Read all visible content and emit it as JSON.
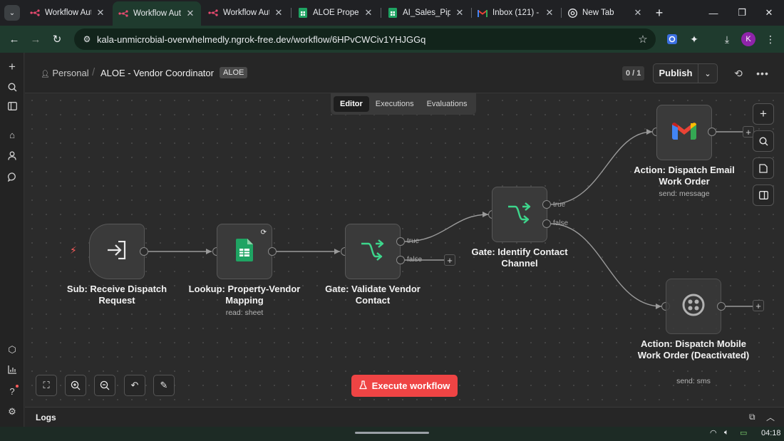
{
  "browser": {
    "tabs": [
      {
        "title": "Workflow Aut",
        "icon": "n8n-icon",
        "active": false
      },
      {
        "title": "Workflow Aut",
        "icon": "n8n-icon",
        "active": true
      },
      {
        "title": "Workflow Aut",
        "icon": "n8n-icon",
        "active": false
      },
      {
        "title": "ALOE Property",
        "icon": "sheets-icon",
        "active": false
      },
      {
        "title": "AI_Sales_Pipel",
        "icon": "sheets-icon",
        "active": false
      },
      {
        "title": "Inbox (121) - ",
        "icon": "gmail-icon",
        "active": false
      },
      {
        "title": "New Tab",
        "icon": "chrome-icon",
        "active": false
      }
    ],
    "url": "kala-unmicrobial-overwhelmedly.ngrok-free.dev/workflow/6HPvCWCiv1YHJGGq",
    "profile_initial": "K",
    "accent_color": "#1f3b2e"
  },
  "header": {
    "project": "Personal",
    "workflow_name": "ALOE - Vendor Coordinator",
    "tag": "ALOE",
    "counter": "0 / 1",
    "publish_label": "Publish"
  },
  "view_tabs": [
    "Editor",
    "Executions",
    "Evaluations"
  ],
  "active_view": "Editor",
  "nodes": [
    {
      "id": "n1",
      "title": "Sub: Receive Dispatch Request",
      "subtitle": "",
      "type": "trigger",
      "icon": "sign-in-icon"
    },
    {
      "id": "n2",
      "title": "Lookup: Property-Vendor Mapping",
      "subtitle": "read: sheet",
      "type": "google-sheets",
      "icon": "sheets-icon"
    },
    {
      "id": "n3",
      "title": "Gate: Validate Vendor Contact",
      "subtitle": "",
      "type": "if",
      "icon": "branch-icon"
    },
    {
      "id": "n4",
      "title": "Gate: Identify Contact Channel",
      "subtitle": "",
      "type": "if",
      "icon": "branch-icon"
    },
    {
      "id": "n5",
      "title": "Action: Dispatch Email Work Order",
      "subtitle": "send: message",
      "type": "gmail",
      "icon": "gmail-icon"
    },
    {
      "id": "n6",
      "title": "Action: Dispatch Mobile Work Order (Deactivated)",
      "subtitle": "send: sms",
      "type": "twilio",
      "icon": "twilio-icon"
    }
  ],
  "branch_labels": {
    "true": "true",
    "false": "false"
  },
  "execute_label": "Execute workflow",
  "logs_label": "Logs",
  "clock": "04:18",
  "colors": {
    "execute": "#ef4444",
    "if_icon": "#3dd68c",
    "sheets": "#1fa463",
    "trigger_bolt": "#ff5c5c"
  }
}
